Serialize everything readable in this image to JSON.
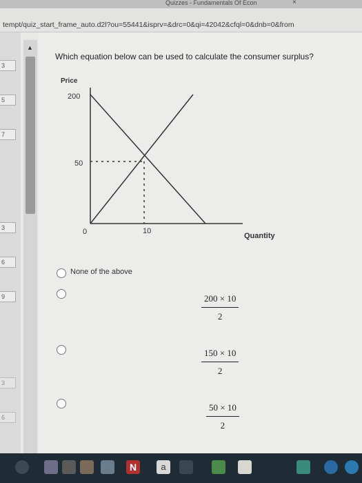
{
  "browser": {
    "tab_title": "Quizzes - Fundamentals Of Econ",
    "close_symbol": "×",
    "url_path": "tempt/quiz_start_frame_auto.d2l?ou=55441&isprv=&drc=0&qi=42042&cfql=0&dnb=0&from",
    "url_query": ""
  },
  "sidebar": {
    "question_numbers": [
      "3",
      "5",
      "7",
      "3",
      "6",
      "9",
      "3",
      "6"
    ]
  },
  "question": {
    "text": "Which equation below can be used to calculate the consumer surplus?"
  },
  "graph": {
    "y_label": "Price",
    "x_label": "Quantity",
    "tick_200": "200",
    "tick_50": "50",
    "origin": "0",
    "tick_10": "10"
  },
  "options": [
    {
      "label": "None of the above"
    },
    {
      "numerator": "200 × 10",
      "denominator": "2"
    },
    {
      "numerator": "150 × 10",
      "denominator": "2"
    },
    {
      "numerator": "50 × 10",
      "denominator": "2"
    }
  ],
  "taskbar": {
    "a_icon_label": "a",
    "n_icon_label": "N"
  }
}
